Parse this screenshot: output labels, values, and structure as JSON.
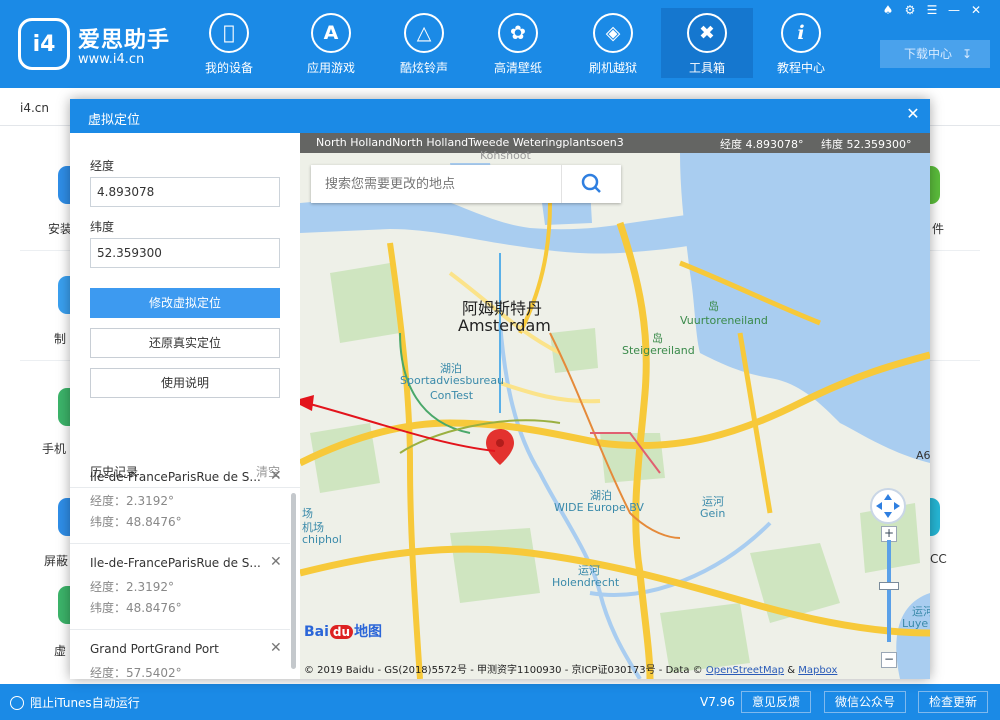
{
  "app": {
    "brand": "爱思助手",
    "site": "www.i4.cn",
    "logo_text": "i4",
    "nav": [
      {
        "label": "我的设备",
        "icon": "apple-icon"
      },
      {
        "label": "应用游戏",
        "icon": "app-store-icon"
      },
      {
        "label": "酷炫铃声",
        "icon": "bell-icon"
      },
      {
        "label": "高清壁纸",
        "icon": "flower-icon"
      },
      {
        "label": "刷机越狱",
        "icon": "box-icon"
      },
      {
        "label": "工具箱",
        "icon": "tools-icon"
      },
      {
        "label": "教程中心",
        "icon": "info-icon"
      }
    ],
    "active_nav": "工具箱",
    "download_center": "下载中心",
    "tab": "i4.cn"
  },
  "background_labels": {
    "l1": "安装",
    "l2": "制",
    "l3": "手机",
    "l4": "屏蔽",
    "l5": "虚",
    "r1": "件",
    "r2": "CC"
  },
  "statusbar": {
    "itunes": "阻止iTunes自动运行",
    "version": "V7.96",
    "feedback": "意见反馈",
    "wechat": "微信公众号",
    "update": "检查更新"
  },
  "dialog": {
    "title": "虚拟定位",
    "longitude_label": "经度",
    "longitude_value": "4.893078",
    "latitude_label": "纬度",
    "latitude_value": "52.359300",
    "modify_button": "修改虚拟定位",
    "restore_button": "还原真实定位",
    "help_button": "使用说明",
    "history_title": "历史记录",
    "history_clear": "清空",
    "history": [
      {
        "name": "Ile-de-FranceParisRue de S...",
        "lng": "经度：2.3192°",
        "lat": "纬度：48.8476°"
      },
      {
        "name": "Ile-de-FranceParisRue de S...",
        "lng": "经度：2.3192°",
        "lat": "纬度：48.8476°"
      },
      {
        "name": "Grand PortGrand Port",
        "lng": "经度：57.5402°",
        "lat": ""
      }
    ]
  },
  "map": {
    "address": "North HollandNorth HollandTweede Weteringplantsoen3",
    "lng_display": "经度 4.893078°",
    "lat_display": "纬度 52.359300°",
    "search_placeholder": "搜索您需要更改的地点",
    "labels": {
      "city_cn": "阿姆斯特丹",
      "city_en": "Amsterdam",
      "vuurtoreneiland": "Vuurtoreneiland",
      "dao1": "岛",
      "dao2": "岛",
      "steigereiland": "Steigereiland",
      "hupo1": "湖泊",
      "sportadvies": "Sportadviesbureau",
      "contest": "ConTest",
      "hupo2": "湖泊",
      "wide": "WIDE Europe BV",
      "yunhe1": "运河",
      "gein": "Gein",
      "yunhe2": "运河",
      "holendrecht": "Holendrecht",
      "airport1": "场",
      "airport2": "机场",
      "schiphol": "chiphol",
      "yunhe3": "运河",
      "luye": "Luye",
      "a6": "A6",
      "kohshoot": "Kohshoot"
    },
    "brand_left": "Bai",
    "brand_du": "du",
    "brand_right": "地图",
    "copyright": "© 2019 Baidu - GS(2018)5572号 - 甲测资字1100930 - 京ICP证030173号 - Data ©",
    "osm": "OpenStreetMap",
    "amp": "&",
    "mapbox": "Mapbox",
    "zoom_in": "+",
    "zoom_out": "−"
  },
  "colors": {
    "brand_blue": "#1b8ae6",
    "primary_button": "#3d9af0",
    "water": "#a9cdf0",
    "park": "#cfe5c0",
    "highway": "#f7c93a",
    "pin": "#e3322f",
    "arrow": "#e3141c"
  }
}
